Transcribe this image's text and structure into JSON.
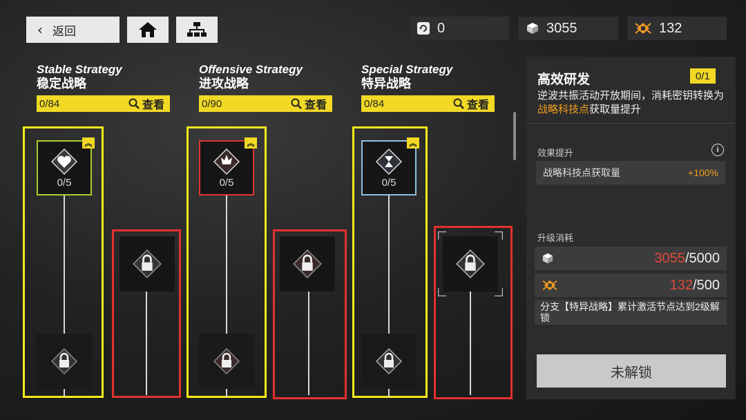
{
  "topbar": {
    "back_label": "返回",
    "resources": [
      {
        "icon": "refresh-icon",
        "value": "0"
      },
      {
        "icon": "cube-icon",
        "value": "3055"
      },
      {
        "icon": "chip-icon",
        "value": "132"
      }
    ]
  },
  "branches": [
    {
      "title_en": "Stable Strategy",
      "title_cn": "稳定战略",
      "progress": "0/84",
      "view_label": "查看",
      "node_count": "0/5",
      "node_color": "#a8d12e",
      "icon": "heart-icon"
    },
    {
      "title_en": "Offensive Strategy",
      "title_cn": "进攻战略",
      "progress": "0/90",
      "view_label": "查看",
      "node_count": "0/5",
      "node_color": "#e03434",
      "icon": "flame-icon"
    },
    {
      "title_en": "Special Strategy",
      "title_cn": "特异战略",
      "progress": "0/84",
      "view_label": "查看",
      "node_count": "0/5",
      "node_color": "#8fc0e0",
      "icon": "hourglass-icon"
    }
  ],
  "panel": {
    "title": "高效研发",
    "tag": "0/1",
    "desc_prefix": "逆波共振活动开放期间，消耗密钥转换为",
    "desc_highlight": "战略科技点",
    "desc_suffix": "获取量提升",
    "effect_label": "效果提升",
    "effect_name": "战略科技点获取量",
    "effect_value": "+100%",
    "cost_label": "升级消耗",
    "cost1_have": "3055",
    "cost1_need": "/5000",
    "cost2_have": "132",
    "cost2_need": "/500",
    "requirement": "分支【特异战略】累计激活节点达到2级解锁",
    "button_label": "未解锁",
    "colors": {
      "accent": "#f1d925",
      "warn": "#e04a3a",
      "highlight": "#f0a020"
    }
  }
}
